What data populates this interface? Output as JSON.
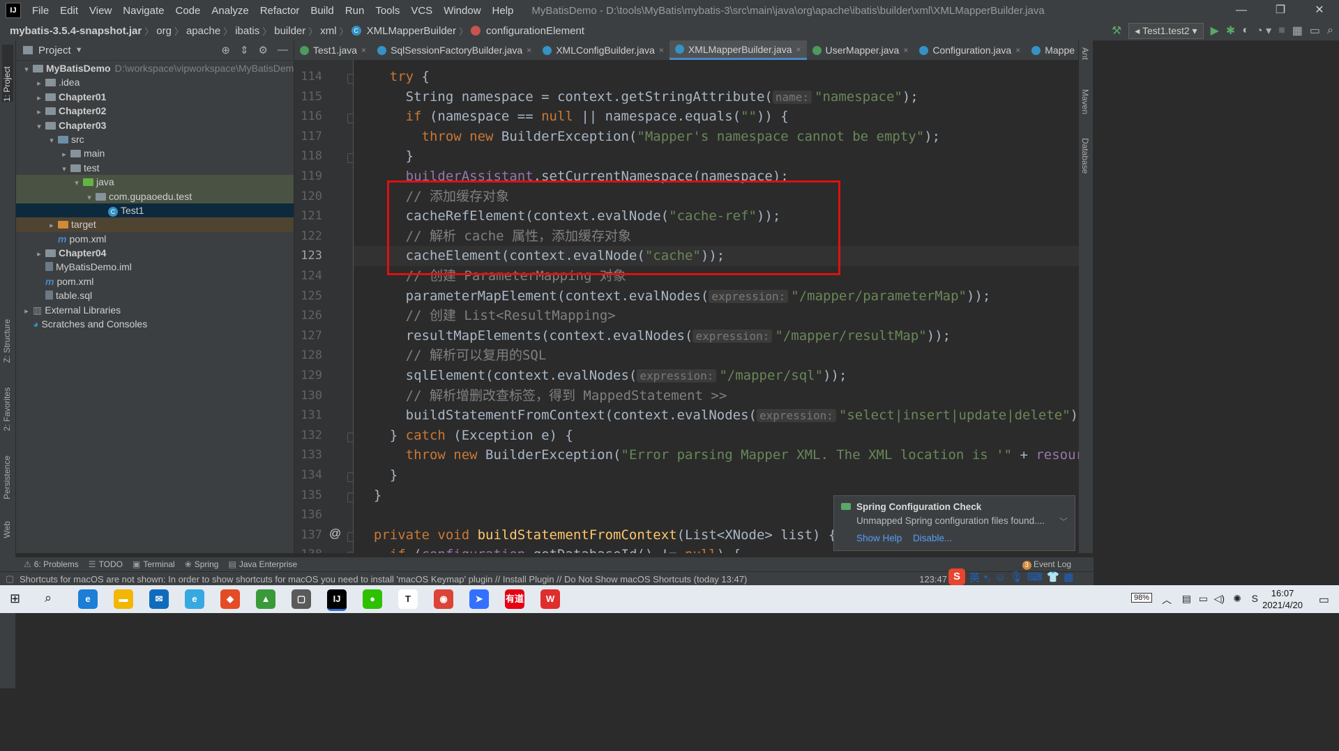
{
  "window": {
    "title": "MyBatisDemo - D:\\tools\\MyBatis\\mybatis-3\\src\\main\\java\\org\\apache\\ibatis\\builder\\xml\\XMLMapperBuilder.java",
    "logo": "IJ",
    "menu": [
      "File",
      "Edit",
      "View",
      "Navigate",
      "Code",
      "Analyze",
      "Refactor",
      "Build",
      "Run",
      "Tools",
      "VCS",
      "Window",
      "Help"
    ],
    "controls": [
      "—",
      "❐",
      "✕"
    ]
  },
  "navbar": {
    "crumbs": [
      "mybatis-3.5.4-snapshot.jar",
      "org",
      "apache",
      "ibatis",
      "builder",
      "xml"
    ],
    "class_crumb": "XMLMapperBuilder",
    "method_crumb": "configurationElement",
    "run_config": "Test1.test2"
  },
  "left_strip": {
    "project_label": "1: Project",
    "structure_label": "Z: Structure",
    "favorites_label": "2: Favorites",
    "persistence_label": "Persistence",
    "web_label": "Web"
  },
  "right_strip": {
    "ant_label": "Ant",
    "maven_label": "Maven",
    "database_label": "Database"
  },
  "project_panel": {
    "title": "Project",
    "tree": [
      {
        "label": "MyBatisDemo",
        "path": "D:\\workspace\\vipworkspace\\MyBatisDemo",
        "depth": 0,
        "arrow": "▾",
        "icon": "folder",
        "bold": true
      },
      {
        "label": ".idea",
        "depth": 1,
        "arrow": "▸",
        "icon": "folder"
      },
      {
        "label": "Chapter01",
        "depth": 1,
        "arrow": "▸",
        "icon": "folder",
        "bold": true
      },
      {
        "label": "Chapter02",
        "depth": 1,
        "arrow": "▸",
        "icon": "folder",
        "bold": true
      },
      {
        "label": "Chapter03",
        "depth": 1,
        "arrow": "▾",
        "icon": "folder",
        "bold": true
      },
      {
        "label": "src",
        "depth": 2,
        "arrow": "▾",
        "icon": "src"
      },
      {
        "label": "main",
        "depth": 3,
        "arrow": "▸",
        "icon": "folder"
      },
      {
        "label": "test",
        "depth": 3,
        "arrow": "▾",
        "icon": "folder"
      },
      {
        "label": "java",
        "depth": 4,
        "arrow": "▾",
        "icon": "green",
        "state": "hl"
      },
      {
        "label": "com.gupaoedu.test",
        "depth": 5,
        "arrow": "▾",
        "icon": "folder",
        "state": "hl"
      },
      {
        "label": "Test1",
        "depth": 6,
        "arrow": "",
        "icon": "class",
        "state": "sel"
      },
      {
        "label": "target",
        "depth": 2,
        "arrow": "▸",
        "icon": "orange",
        "state": "target"
      },
      {
        "label": "pom.xml",
        "depth": 2,
        "arrow": "",
        "icon": "maven"
      },
      {
        "label": "Chapter04",
        "depth": 1,
        "arrow": "▸",
        "icon": "folder",
        "bold": true
      },
      {
        "label": "MyBatisDemo.iml",
        "depth": 1,
        "arrow": "",
        "icon": "file"
      },
      {
        "label": "pom.xml",
        "depth": 1,
        "arrow": "",
        "icon": "maven"
      },
      {
        "label": "table.sql",
        "depth": 1,
        "arrow": "",
        "icon": "file"
      },
      {
        "label": "External Libraries",
        "depth": 0,
        "arrow": "▸",
        "icon": "lib"
      },
      {
        "label": "Scratches and Consoles",
        "depth": 0,
        "arrow": "",
        "icon": "scratch"
      }
    ]
  },
  "tabs": [
    {
      "label": "Test1.java",
      "icon": "green",
      "active": false
    },
    {
      "label": "SqlSessionFactoryBuilder.java",
      "icon": "blue",
      "active": false
    },
    {
      "label": "XMLConfigBuilder.java",
      "icon": "blue",
      "active": false
    },
    {
      "label": "XMLMapperBuilder.java",
      "icon": "blue",
      "active": true
    },
    {
      "label": "UserMapper.java",
      "icon": "green",
      "active": false
    },
    {
      "label": "Configuration.java",
      "icon": "blue",
      "active": false
    },
    {
      "label": "Mappe",
      "icon": "blue",
      "active": false
    }
  ],
  "editor": {
    "current_line": 123,
    "lines": [
      {
        "n": 114,
        "parts": [
          [
            "kw",
            "    try "
          ],
          [
            "",
            "{"
          ]
        ]
      },
      {
        "n": 115,
        "parts": [
          [
            "",
            "      String namespace = context.getStringAttribute("
          ],
          [
            "hint",
            "name:"
          ],
          [
            "str",
            "\"namespace\""
          ],
          [
            "",
            ");"
          ]
        ]
      },
      {
        "n": 116,
        "parts": [
          [
            "kw",
            "      if "
          ],
          [
            "",
            "(namespace == "
          ],
          [
            "kw",
            "null"
          ],
          [
            "",
            " || namespace.equals("
          ],
          [
            "str",
            "\"\""
          ],
          [
            "",
            ")) {"
          ]
        ]
      },
      {
        "n": 117,
        "parts": [
          [
            "kw",
            "        throw new "
          ],
          [
            "",
            "BuilderException("
          ],
          [
            "str",
            "\"Mapper's namespace cannot be empty\""
          ],
          [
            "",
            ");"
          ]
        ]
      },
      {
        "n": 118,
        "parts": [
          [
            "",
            "      }"
          ]
        ]
      },
      {
        "n": 119,
        "parts": [
          [
            "fld",
            "      builderAssistant"
          ],
          [
            "",
            ".setCurrentNamespace(namespace);"
          ]
        ]
      },
      {
        "n": 120,
        "parts": [
          [
            "cm",
            "      // 添加缓存对象"
          ]
        ]
      },
      {
        "n": 121,
        "parts": [
          [
            "",
            "      cacheRefElement(context.evalNode("
          ],
          [
            "str",
            "\"cache-ref\""
          ],
          [
            "",
            "));"
          ]
        ]
      },
      {
        "n": 122,
        "parts": [
          [
            "cm",
            "      // 解析 cache 属性，添加缓存对象"
          ]
        ]
      },
      {
        "n": 123,
        "parts": [
          [
            "",
            "      cacheElement(context.evalNode("
          ],
          [
            "str",
            "\"cache\""
          ],
          [
            "",
            "));"
          ]
        ]
      },
      {
        "n": 124,
        "parts": [
          [
            "cm",
            "      // 创建 ParameterMapping 对象"
          ]
        ]
      },
      {
        "n": 125,
        "parts": [
          [
            "",
            "      parameterMapElement(context.evalNodes("
          ],
          [
            "hint",
            "expression:"
          ],
          [
            "str",
            "\"/mapper/parameterMap\""
          ],
          [
            "",
            "));"
          ]
        ]
      },
      {
        "n": 126,
        "parts": [
          [
            "cm",
            "      // 创建 List<ResultMapping>"
          ]
        ]
      },
      {
        "n": 127,
        "parts": [
          [
            "",
            "      resultMapElements(context.evalNodes("
          ],
          [
            "hint",
            "expression:"
          ],
          [
            "str",
            "\"/mapper/resultMap\""
          ],
          [
            "",
            "));"
          ]
        ]
      },
      {
        "n": 128,
        "parts": [
          [
            "cm",
            "      // 解析可以复用的SQL"
          ]
        ]
      },
      {
        "n": 129,
        "parts": [
          [
            "",
            "      sqlElement(context.evalNodes("
          ],
          [
            "hint",
            "expression:"
          ],
          [
            "str",
            "\"/mapper/sql\""
          ],
          [
            "",
            "));"
          ]
        ]
      },
      {
        "n": 130,
        "parts": [
          [
            "cm",
            "      // 解析增删改查标签，得到 MappedStatement >>"
          ]
        ]
      },
      {
        "n": 131,
        "parts": [
          [
            "",
            "      buildStatementFromContext(context.evalNodes("
          ],
          [
            "hint",
            "expression:"
          ],
          [
            "str",
            "\"select|insert|update|delete\""
          ],
          [
            "",
            "));"
          ]
        ]
      },
      {
        "n": 132,
        "parts": [
          [
            "",
            "    } "
          ],
          [
            "kw",
            "catch "
          ],
          [
            "",
            "(Exception e) {"
          ]
        ]
      },
      {
        "n": 133,
        "parts": [
          [
            "kw",
            "      throw new "
          ],
          [
            "",
            "BuilderException("
          ],
          [
            "str",
            "\"Error parsing Mapper XML. The XML location is '\""
          ],
          [
            "",
            " + "
          ],
          [
            "fld",
            "resour"
          ]
        ]
      },
      {
        "n": 134,
        "parts": [
          [
            "",
            "    }"
          ]
        ]
      },
      {
        "n": 135,
        "parts": [
          [
            "",
            "  }"
          ]
        ]
      },
      {
        "n": 136,
        "parts": [
          [
            "",
            ""
          ]
        ]
      },
      {
        "n": 137,
        "parts": [
          [
            "kw",
            "  private void "
          ],
          [
            "mth",
            "buildStatementFromContext"
          ],
          [
            "",
            "(List<XNode> list) {"
          ]
        ]
      },
      {
        "n": 138,
        "parts": [
          [
            "kw",
            "    if "
          ],
          [
            "",
            "("
          ],
          [
            "fld",
            "configuration"
          ],
          [
            "",
            ".getDatabaseId() != "
          ],
          [
            "kw",
            "null"
          ],
          [
            "",
            ") {"
          ]
        ]
      }
    ]
  },
  "notification": {
    "title": "Spring Configuration Check",
    "body": "Unmapped Spring configuration files found....",
    "link1": "Show Help",
    "link2": "Disable..."
  },
  "bottom_tools": [
    {
      "icon": "⚠",
      "label": "6: Problems"
    },
    {
      "icon": "☰",
      "label": "TODO"
    },
    {
      "icon": "▣",
      "label": "Terminal"
    },
    {
      "icon": "❀",
      "label": "Spring"
    },
    {
      "icon": "▤",
      "label": "Java Enterprise"
    }
  ],
  "event_log": {
    "badge": "3",
    "label": "Event Log"
  },
  "status": {
    "message": "Shortcuts for macOS are not shown: In order to show shortcuts for macOS you need to install 'macOS Keymap' plugin // Install Plugin // Do Not Show macOS Shortcuts (today 13:47)",
    "position": "123:47"
  },
  "ime": {
    "logo": "S",
    "mode": "英"
  },
  "taskbar": {
    "battery": "98%",
    "time": "16:07",
    "date": "2021/4/20",
    "apps": [
      {
        "name": "edge",
        "label": "e",
        "color": "#1c7ed6"
      },
      {
        "name": "explorer",
        "label": "▬",
        "color": "#f2b705"
      },
      {
        "name": "mail",
        "label": "✉",
        "color": "#0f6cbd"
      },
      {
        "name": "ie",
        "label": "e",
        "color": "#36a9e1"
      },
      {
        "name": "app5",
        "label": "◆",
        "color": "#e34c26"
      },
      {
        "name": "app6",
        "label": "▲",
        "color": "#3a9a3a"
      },
      {
        "name": "remote",
        "label": "▢",
        "color": "#5a5a5a"
      },
      {
        "name": "intellij",
        "label": "IJ",
        "color": "#000000"
      },
      {
        "name": "wechat",
        "label": "●",
        "color": "#2dc100"
      },
      {
        "name": "typora",
        "label": "T",
        "color": "#ffffff"
      },
      {
        "name": "chrome",
        "label": "◉",
        "color": "#db4437"
      },
      {
        "name": "feishu",
        "label": "➤",
        "color": "#3370ff"
      },
      {
        "name": "youdao",
        "label": "有道",
        "color": "#e60012"
      },
      {
        "name": "wps",
        "label": "W",
        "color": "#e02d2d"
      }
    ]
  }
}
